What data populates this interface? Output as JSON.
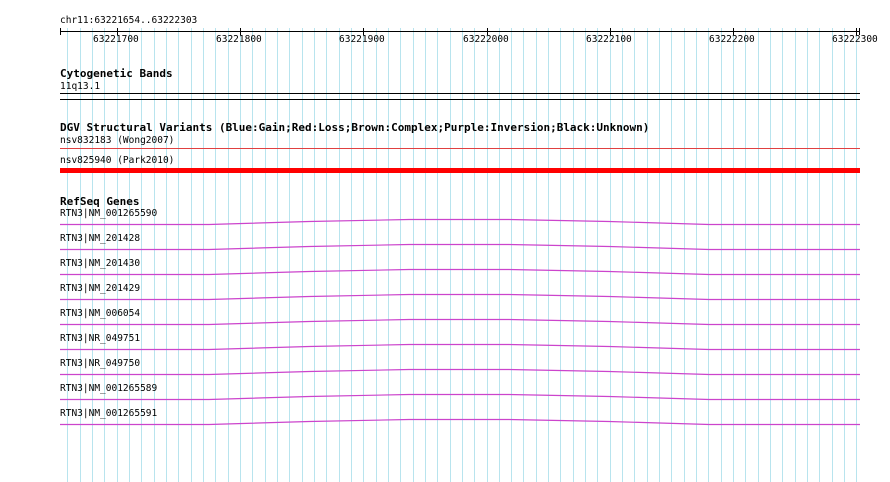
{
  "location": "chr11:63221654..63222303",
  "ruler": {
    "start": 63221654,
    "end": 63222303,
    "tick_step": 10,
    "labels": [
      "63221700",
      "63221800",
      "63221900",
      "63222000",
      "63222100",
      "63222200",
      "63222300"
    ]
  },
  "tracks": {
    "cytoband": {
      "title": "Cytogenetic Bands",
      "band": "11q13.1"
    },
    "dgv": {
      "title": "DGV Structural Variants (Blue:Gain;Red:Loss;Brown:Complex;Purple:Inversion;Black:Unknown)",
      "items": [
        {
          "label": "nsv832183 (Wong2007)",
          "color": "#e04040"
        },
        {
          "label": "nsv825940 (Park2010)",
          "color": "#ff0000"
        }
      ]
    },
    "refseq": {
      "title": "RefSeq Genes",
      "color": "#cc44cc",
      "items": [
        "RTN3|NM_001265590",
        "RTN3|NM_201428",
        "RTN3|NM_201430",
        "RTN3|NM_201429",
        "RTN3|NM_006054",
        "RTN3|NR_049751",
        "RTN3|NR_049750",
        "RTN3|NM_001265589",
        "RTN3|NM_001265591"
      ]
    }
  },
  "colors": {
    "grid": "#b8e4ee",
    "ruler": "#000000"
  }
}
